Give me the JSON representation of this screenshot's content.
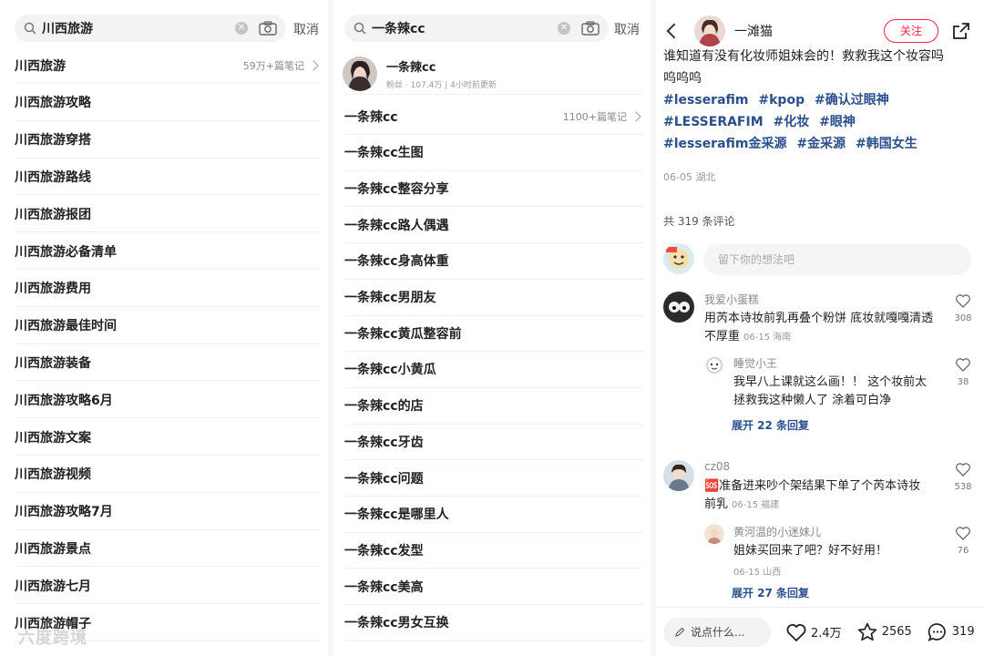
{
  "colors": {
    "accent": "#ff2442",
    "tag_blue": "#2a4f8c",
    "muted": "#999999"
  },
  "panel1": {
    "query": "川西旅游",
    "cancel": "取消",
    "items": [
      {
        "label": "川西旅游",
        "count": "59万+篇笔记"
      },
      {
        "label": "川西旅游攻略"
      },
      {
        "label": "川西旅游穿搭"
      },
      {
        "label": "川西旅游路线"
      },
      {
        "label": "川西旅游报团"
      },
      {
        "label": "川西旅游必备清单"
      },
      {
        "label": "川西旅游费用"
      },
      {
        "label": "川西旅游最佳时间"
      },
      {
        "label": "川西旅游装备"
      },
      {
        "label": "川西旅游攻略6月"
      },
      {
        "label": "川西旅游文案"
      },
      {
        "label": "川西旅游视频"
      },
      {
        "label": "川西旅游攻略7月"
      },
      {
        "label": "川西旅游景点"
      },
      {
        "label": "川西旅游七月"
      },
      {
        "label": "川西旅游帽子"
      }
    ]
  },
  "panel2": {
    "query": "一条辣cc",
    "cancel": "取消",
    "user": {
      "name": "一条辣cc",
      "meta": "粉丝 · 107.4万 | 4小时前更新"
    },
    "items": [
      {
        "label": "一条辣cc",
        "count": "1100+篇笔记"
      },
      {
        "label": "一条辣cc生图"
      },
      {
        "label": "一条辣cc整容分享"
      },
      {
        "label": "一条辣cc路人偶遇"
      },
      {
        "label": "一条辣cc身高体重"
      },
      {
        "label": "一条辣cc男朋友"
      },
      {
        "label": "一条辣cc黄瓜整容前"
      },
      {
        "label": "一条辣cc小黄瓜"
      },
      {
        "label": "一条辣cc的店"
      },
      {
        "label": "一条辣cc牙齿"
      },
      {
        "label": "一条辣cc问题"
      },
      {
        "label": "一条辣cc是哪里人"
      },
      {
        "label": "一条辣cc发型"
      },
      {
        "label": "一条辣cc美高"
      },
      {
        "label": "一条辣cc男女互换"
      }
    ]
  },
  "panel3": {
    "author": "一滩猫",
    "follow": "关注",
    "body_line1": "谁知道有没有化妆师姐妹会的！救救我这个妆容吗",
    "body_line2": "呜呜呜",
    "tags": [
      "#lesserafim",
      "#kpop",
      "#确认过眼神",
      "#LESSERAFIM",
      "#化妆",
      "#眼神",
      "#lesserafim金采源",
      "#金采源",
      "#韩国女生"
    ],
    "date_loc": "06-05 湖北",
    "total_comments": "共 319 条评论",
    "comment_placeholder": "留下你的想法吧",
    "comments": [
      {
        "user": "我爱小蛋糕",
        "text1": "用芮本诗妆前乳再叠个粉饼 底妆就嘎嘎清透",
        "text2": "不厚重",
        "meta": "06-15 海南",
        "likes": "308",
        "reply": {
          "user": "睡觉小王",
          "text1": "我早八上课就这么画！！ 这个妆前太",
          "text2": "拯救我这种懒人了 涂着可白净",
          "likes": "38"
        },
        "expand": "展开 22 条回复"
      },
      {
        "user": "cz08",
        "text1": "🆘准备进来吵个架结果下单了个芮本诗妆",
        "text2": "前乳",
        "meta": "06-15 福建",
        "likes": "538",
        "reply": {
          "user": "黄河温的小迷妹儿",
          "text1": "姐妹买回来了吧？好不好用！",
          "meta": "06-15 山西",
          "likes": "76"
        },
        "expand": "展开 27 条回复"
      }
    ],
    "bottom": {
      "say": "说点什么...",
      "likes": "2.4万",
      "stars": "2565",
      "comments": "319"
    }
  },
  "watermark": "六度跨境"
}
